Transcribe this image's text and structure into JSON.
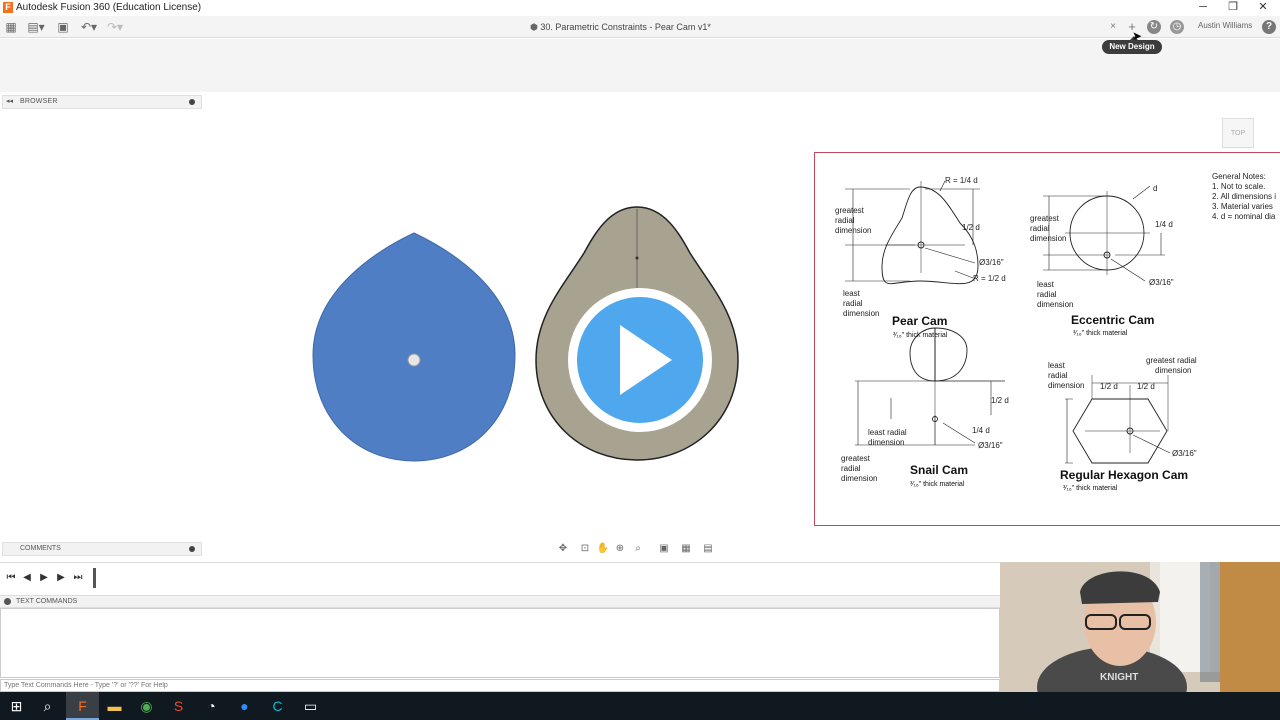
{
  "window": {
    "app_title": "Autodesk Fusion 360 (Education License)",
    "logo_letter": "F",
    "minimize": "─",
    "maximize": "❐",
    "close": "✕"
  },
  "tab": {
    "title": "30. Parametric Constraints - Pear Cam v1*",
    "close": "×",
    "new": "+"
  },
  "header": {
    "user": "Austin Williams",
    "help": "?",
    "tooltip": "New Design"
  },
  "browser": {
    "label": "BROWSER"
  },
  "comments": {
    "label": "COMMENTS"
  },
  "viewcube": {
    "face": "TOP"
  },
  "text_commands": {
    "label": "TEXT COMMANDS",
    "placeholder": "Type Text Commands Here - Type '?' or '??' For Help"
  },
  "drawing": {
    "notes_title": "General Notes:",
    "notes": [
      "1. Not to scale.",
      "2. All dimensions i",
      "3. Material varies",
      "4. d = nominal dia"
    ],
    "cams": [
      {
        "name": "Pear Cam",
        "material": "³⁄₁₆\" thick material"
      },
      {
        "name": "Eccentric Cam",
        "material": "³⁄₁₆\" thick material"
      },
      {
        "name": "Snail Cam",
        "material": "³⁄₁₆\" thick material"
      },
      {
        "name": "Regular Hexagon Cam",
        "material": "³⁄₁₆\" thick material"
      }
    ],
    "pear": {
      "r_top": "R = 1/4 d",
      "half": "1/2 d",
      "hole": "Ø3/16\"",
      "r_bot": "R = 1/2 d",
      "greatest": [
        "greatest",
        "radial",
        "dimension"
      ],
      "least": [
        "least",
        "radial",
        "dimension"
      ]
    },
    "eccentric": {
      "d": "d",
      "quarter": "1/4 d",
      "hole": "Ø3/16\"",
      "greatest": [
        "greatest",
        "radial",
        "dimension"
      ],
      "least": [
        "least",
        "radial",
        "dimension"
      ]
    },
    "snail": {
      "half": "1/2 d",
      "quarter": "1/4 d",
      "hole": "Ø3/16\"",
      "least": [
        "least radial",
        "dimension"
      ],
      "greatest": [
        "greatest",
        "radial",
        "dimension"
      ]
    },
    "hex": {
      "half_l": "1/2 d",
      "half_r": "1/2 d",
      "hole": "Ø3/16\"",
      "least": [
        "least",
        "radial",
        "dimension"
      ],
      "greatest": [
        "greatest radial",
        "dimension"
      ]
    }
  },
  "colors": {
    "blue_cam": "#4f7ec4",
    "tan_cam": "#a8a291",
    "play_button": "#4fa8ee",
    "drawing_border": "#c0485a"
  }
}
